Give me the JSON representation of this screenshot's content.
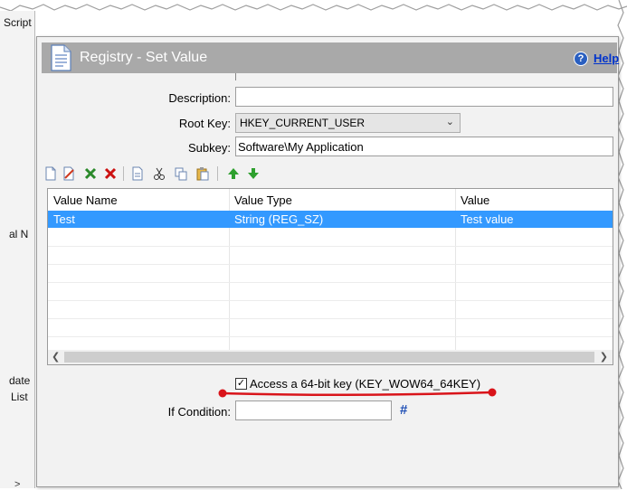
{
  "left_fragments": {
    "script": "Script",
    "nal": "al N",
    "date": "date",
    "list": "List",
    "chevron": ">"
  },
  "dialog": {
    "title": "Registry - Set Value",
    "help_label": "Help",
    "help_glyph": "?"
  },
  "form": {
    "description_label": "Description:",
    "description_value": "",
    "root_key_label": "Root Key:",
    "root_key_value": "HKEY_CURRENT_USER",
    "subkey_label": "Subkey:",
    "subkey_value": "Software\\My Application"
  },
  "table": {
    "columns": [
      "Value Name",
      "Value Type",
      "Value"
    ],
    "rows": [
      {
        "name": "Test",
        "type": "String (REG_SZ)",
        "value": "Test value"
      }
    ]
  },
  "options": {
    "access64_label": "Access a 64-bit key (KEY_WOW64_64KEY)",
    "access64_checked": true,
    "if_condition_label": "If Condition:",
    "if_condition_value": "",
    "hash_glyph": "#"
  },
  "colors": {
    "selection": "#3399ff",
    "titlebar": "#a9a9a9",
    "annotation": "#d9141a"
  }
}
